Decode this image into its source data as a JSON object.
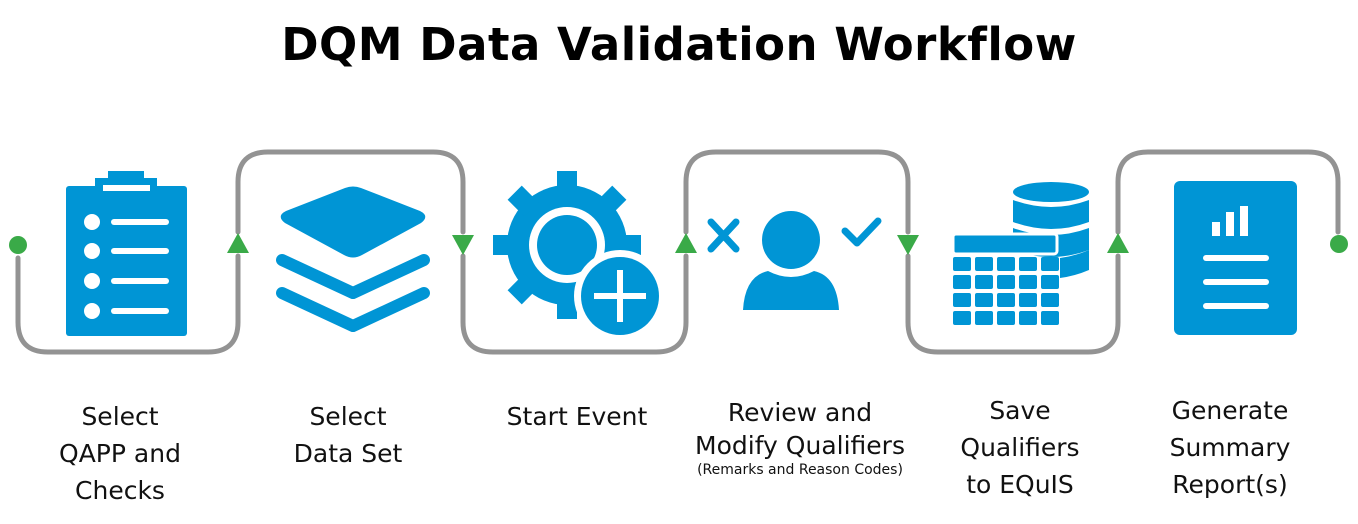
{
  "title": "DQM Data Validation Workflow",
  "colors": {
    "icon_blue": "#0095D5",
    "connector_gray": "#939393",
    "marker_green": "#3AAA48"
  },
  "steps": [
    {
      "icon": "clipboard-checklist-icon",
      "label_lines": [
        "Select",
        "QAPP and",
        "Checks"
      ],
      "sub": ""
    },
    {
      "icon": "layers-stack-icon",
      "label_lines": [
        "Select",
        "Data Set"
      ],
      "sub": ""
    },
    {
      "icon": "gear-plus-icon",
      "label_lines": [
        "Start Event"
      ],
      "sub": ""
    },
    {
      "icon": "user-review-icon",
      "label_lines": [
        "Review and",
        "Modify Qualifiers"
      ],
      "sub": "(Remarks and Reason Codes)"
    },
    {
      "icon": "table-database-icon",
      "label_lines": [
        "Save",
        "Qualifiers",
        "to EQuIS"
      ],
      "sub": ""
    },
    {
      "icon": "report-document-icon",
      "label_lines": [
        "Generate",
        "Summary",
        "Report(s)"
      ],
      "sub": ""
    }
  ]
}
